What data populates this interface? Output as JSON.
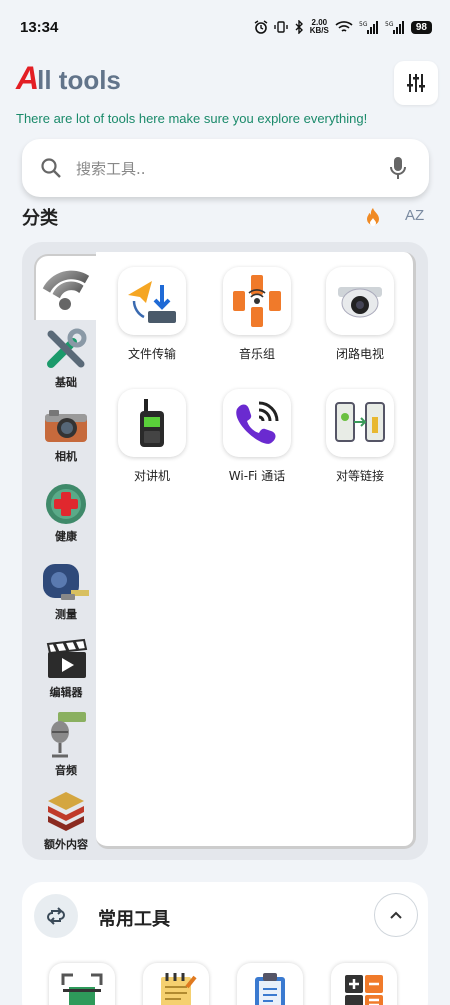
{
  "status_bar": {
    "time": "13:34",
    "speed_value": "2.00",
    "speed_unit": "KB/S",
    "battery": "98"
  },
  "header": {
    "title_first_letter": "A",
    "title_rest": "ll tools",
    "tagline": "There are lot of tools here make sure you explore everything!"
  },
  "search": {
    "placeholder": "搜索工具.."
  },
  "categories_section": {
    "title": "分类",
    "sort_icon_text": "AZ",
    "items": [
      {
        "label": "",
        "icon": "wifi-icon",
        "active": true
      },
      {
        "label": "基础",
        "icon": "tools-icon"
      },
      {
        "label": "相机",
        "icon": "camera-icon"
      },
      {
        "label": "健康",
        "icon": "health-cross-icon"
      },
      {
        "label": "测量",
        "icon": "tape-measure-icon"
      },
      {
        "label": "编辑器",
        "icon": "clapperboard-icon"
      },
      {
        "label": "音频",
        "icon": "microphone-icon"
      },
      {
        "label": "额外内容",
        "icon": "stack-layers-icon"
      }
    ]
  },
  "tools": [
    {
      "label": "文件传输",
      "icon": "file-transfer-icon"
    },
    {
      "label": "音乐组",
      "icon": "music-group-icon"
    },
    {
      "label": "闭路电视",
      "icon": "cctv-camera-icon"
    },
    {
      "label": "对讲机",
      "icon": "walkie-talkie-icon"
    },
    {
      "label": "Wi-Fi 通话",
      "icon": "wifi-call-icon"
    },
    {
      "label": "对等链接",
      "icon": "peer-link-icon"
    }
  ],
  "common_tools": {
    "title": "常用工具",
    "items": [
      {
        "icon": "scanner-icon"
      },
      {
        "icon": "notepad-icon"
      },
      {
        "icon": "clipboard-icon"
      },
      {
        "icon": "calculator-icon"
      }
    ]
  },
  "colors": {
    "accent_red": "#e31e24",
    "title_gray": "#62748a",
    "tagline_green": "#1a8a6a",
    "fire_orange": "#f08a24"
  }
}
